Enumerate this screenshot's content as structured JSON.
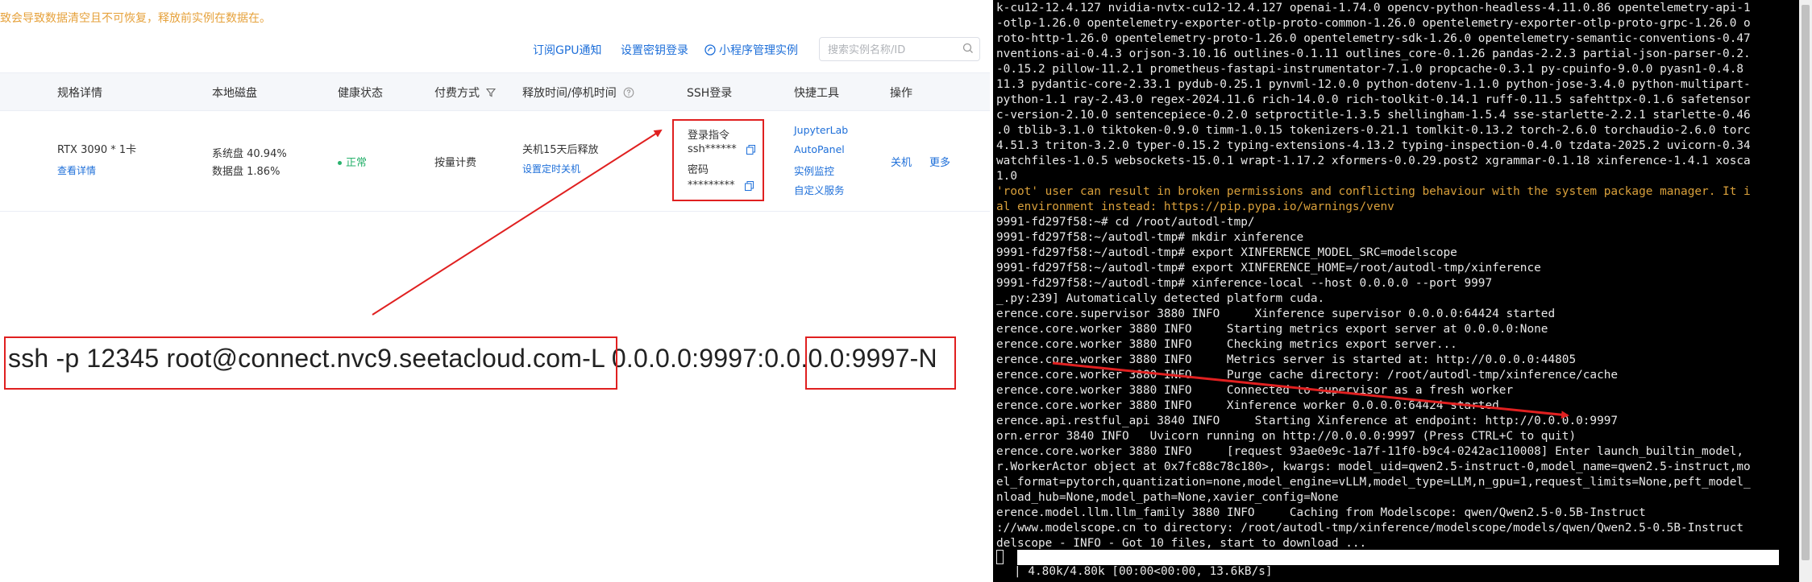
{
  "console": {
    "warning": "致会导致数据清空且不可恢复，释放前实例在数据在。",
    "toolbar": {
      "subscribe_gpu": "订阅GPU通知",
      "key_login": "设置密钥登录",
      "miniprogram": "小程序管理实例",
      "search_placeholder": "搜索实例名称/ID"
    },
    "headers": {
      "spec": "规格详情",
      "disk": "本地磁盘",
      "health": "健康状态",
      "billing": "付费方式",
      "release": "释放时间/停机时间",
      "ssh": "SSH登录",
      "tools": "快捷工具",
      "actions": "操作"
    },
    "row": {
      "gpu": "RTX 3090 * 1卡",
      "view_details": "查看详情",
      "system_disk": "系统盘 40.94%",
      "data_disk": "数据盘 1.86%",
      "health": "正常",
      "billing": "按量计费",
      "release_note": "关机15天后释放",
      "set_shutdown": "设置定时关机",
      "login_cmd_label": "登录指令",
      "login_cmd_value": "ssh******",
      "password_label": "密码",
      "password_value": "*********",
      "tools": [
        "JupyterLab",
        "AutoPanel",
        "实例监控",
        "自定义服务"
      ],
      "shutdown": "关机",
      "more": "更多"
    },
    "command": {
      "part1": "ssh -p 12345 root@connect.nvc9.seetacloud.com",
      "part2": " -L 0.0.0.0:9997:",
      "part3": "0.0.0.0:9997",
      "part4": " -N"
    }
  },
  "terminal": {
    "lines": [
      "k-cu12-12.4.127 nvidia-nvtx-cu12-12.4.127 openai-1.74.0 opencv-python-headless-4.11.0.86 opentelemetry-api-1",
      "-otlp-1.26.0 opentelemetry-exporter-otlp-proto-common-1.26.0 opentelemetry-exporter-otlp-proto-grpc-1.26.0 o",
      "roto-http-1.26.0 opentelemetry-proto-1.26.0 opentelemetry-sdk-1.26.0 opentelemetry-semantic-conventions-0.47",
      "nventions-ai-0.4.3 orjson-3.10.16 outlines-0.1.11 outlines_core-0.1.26 pandas-2.2.3 partial-json-parser-0.2.",
      "-0.15.2 pillow-11.2.1 prometheus-fastapi-instrumentator-7.1.0 propcache-0.3.1 py-cpuinfo-9.0.0 pyasn1-0.4.8",
      "11.3 pydantic-core-2.33.1 pydub-0.25.1 pynvml-12.0.0 python-dotenv-1.1.0 python-jose-3.4.0 python-multipart-",
      "python-1.1 ray-2.43.0 regex-2024.11.6 rich-14.0.0 rich-toolkit-0.14.1 ruff-0.11.5 safehttpx-0.1.6 safetensor",
      "c-version-2.10.0 sentencepiece-0.2.0 setproctitle-1.3.5 shellingham-1.5.4 sse-starlette-2.2.1 starlette-0.46",
      ".0 tblib-3.1.0 tiktoken-0.9.0 timm-1.0.15 tokenizers-0.21.1 tomlkit-0.13.2 torch-2.6.0 torchaudio-2.6.0 torc",
      "4.51.3 triton-3.2.0 typer-0.15.2 typing-extensions-4.13.2 typing-inspection-0.4.0 tzdata-2025.2 uvicorn-0.34",
      "watchfiles-1.0.5 websockets-15.0.1 wrapt-1.17.2 xformers-0.0.29.post2 xgrammar-0.1.18 xinference-1.4.1 xosca",
      "1.0",
      "'root' user can result in broken permissions and conflicting behaviour with the system package manager. It i",
      "al environment instead: https://pip.pypa.io/warnings/venv",
      "9991-fd297f58:~# cd /root/autodl-tmp/",
      "9991-fd297f58:~/autodl-tmp# mkdir xinference",
      "9991-fd297f58:~/autodl-tmp# export XINFERENCE_MODEL_SRC=modelscope",
      "9991-fd297f58:~/autodl-tmp# export XINFERENCE_HOME=/root/autodl-tmp/xinference",
      "9991-fd297f58:~/autodl-tmp# xinference-local --host 0.0.0.0 --port 9997",
      "_.py:239] Automatically detected platform cuda.",
      "erence.core.supervisor 3880 INFO     Xinference supervisor 0.0.0.0:64424 started",
      "erence.core.worker 3880 INFO     Starting metrics export server at 0.0.0.0:None",
      "erence.core.worker 3880 INFO     Checking metrics export server...",
      "erence.core.worker 3880 INFO     Metrics server is started at: http://0.0.0.0:44805",
      "erence.core.worker 3880 INFO     Purge cache directory: /root/autodl-tmp/xinference/cache",
      "erence.core.worker 3880 INFO     Connected to supervisor as a fresh worker",
      "erence.core.worker 3880 INFO     Xinference worker 0.0.0.0:64424 started",
      "erence.api.restful_api 3840 INFO     Starting Xinference at endpoint: http://0.0.0.0:9997",
      "orn.error 3840 INFO   Uvicorn running on http://0.0.0.0:9997 (Press CTRL+C to quit)",
      "erence.core.worker 3880 INFO     [request 93ae0e9c-1a7f-11f0-b9c4-0242ac110008] Enter launch_builtin_model,",
      "r.WorkerActor object at 0x7fc88c78c180>, kwargs: model_uid=qwen2.5-instruct-0,model_name=qwen2.5-instruct,mo",
      "el_format=pytorch,quantization=none,model_engine=vLLM,model_type=LLM,n_gpu=1,request_limits=None,peft_model_",
      "nload_hub=None,model_path=None,xavier_config=None",
      "erence.model.llm.llm_family 3880 INFO     Caching from Modelscope: qwen/Qwen2.5-0.5B-Instruct",
      "://www.modelscope.cn to directory: /root/autodl-tmp/xinference/modelscope/models/qwen/Qwen2.5-0.5B-Instruct",
      "delscope - INFO - Got 10 files, start to download ..."
    ],
    "progress": "| 4.80k/4.80k [00:00<00:00, 13.6kB/s]"
  }
}
